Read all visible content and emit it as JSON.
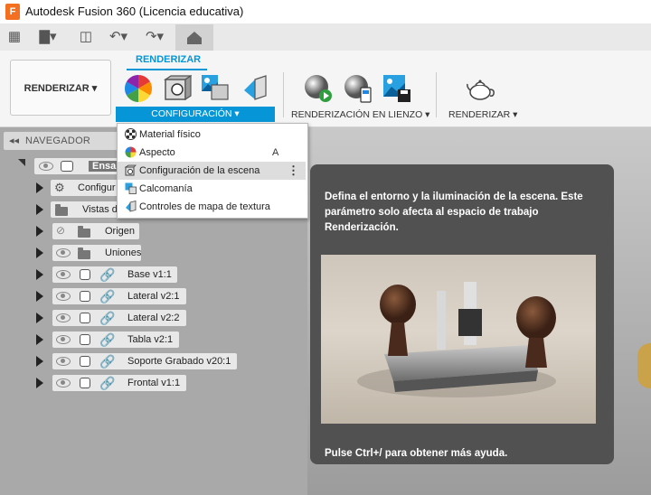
{
  "title_bar": {
    "title": "Autodesk Fusion 360 (Licencia educativa)",
    "app_icon_letter": "F"
  },
  "ribbon": {
    "workspace_button": "RENDERIZAR ▾",
    "active_tab": "RENDERIZAR",
    "groups": {
      "configuracion": "CONFIGURACIÓN ▾",
      "render_lienzo": "RENDERIZACIÓN EN LIENZO ▾",
      "renderizar": "RENDERIZAR ▾"
    }
  },
  "navigator": {
    "header": "NAVEGADOR",
    "rows": [
      {
        "label": "Ensam",
        "kind": "root"
      },
      {
        "label": "Configur",
        "kind": "settings"
      },
      {
        "label": "Vistas d",
        "kind": "folder"
      },
      {
        "label": "Origen",
        "kind": "folder-hidden"
      },
      {
        "label": "Uniones",
        "kind": "folder"
      },
      {
        "label": "Base v1:1",
        "kind": "component"
      },
      {
        "label": "Lateral v2:1",
        "kind": "component"
      },
      {
        "label": "Lateral v2:2",
        "kind": "component"
      },
      {
        "label": "Tabla v2:1",
        "kind": "component"
      },
      {
        "label": "Soporte Grabado v20:1",
        "kind": "component"
      },
      {
        "label": "Frontal v1:1",
        "kind": "component"
      }
    ]
  },
  "dropdown": {
    "items": [
      {
        "label": "Material físico",
        "icon": "material-checker-icon"
      },
      {
        "label": "Aspecto",
        "icon": "color-wheel-icon",
        "shortcut": "A"
      },
      {
        "label": "Configuración de la escena",
        "icon": "scene-settings-icon"
      },
      {
        "label": "Calcomanía",
        "icon": "decal-icon"
      },
      {
        "label": "Controles de mapa de textura",
        "icon": "texture-map-icon"
      }
    ]
  },
  "tooltip": {
    "description": "Defina el entorno y la iluminación de la escena. Este parámetro solo afecta al espacio de trabajo Renderización.",
    "help": "Pulse Ctrl+/ para obtener más ayuda."
  },
  "colors": {
    "accent": "#0696d7",
    "tooltip_bg": "#515151",
    "app_icon": "#f37021"
  }
}
